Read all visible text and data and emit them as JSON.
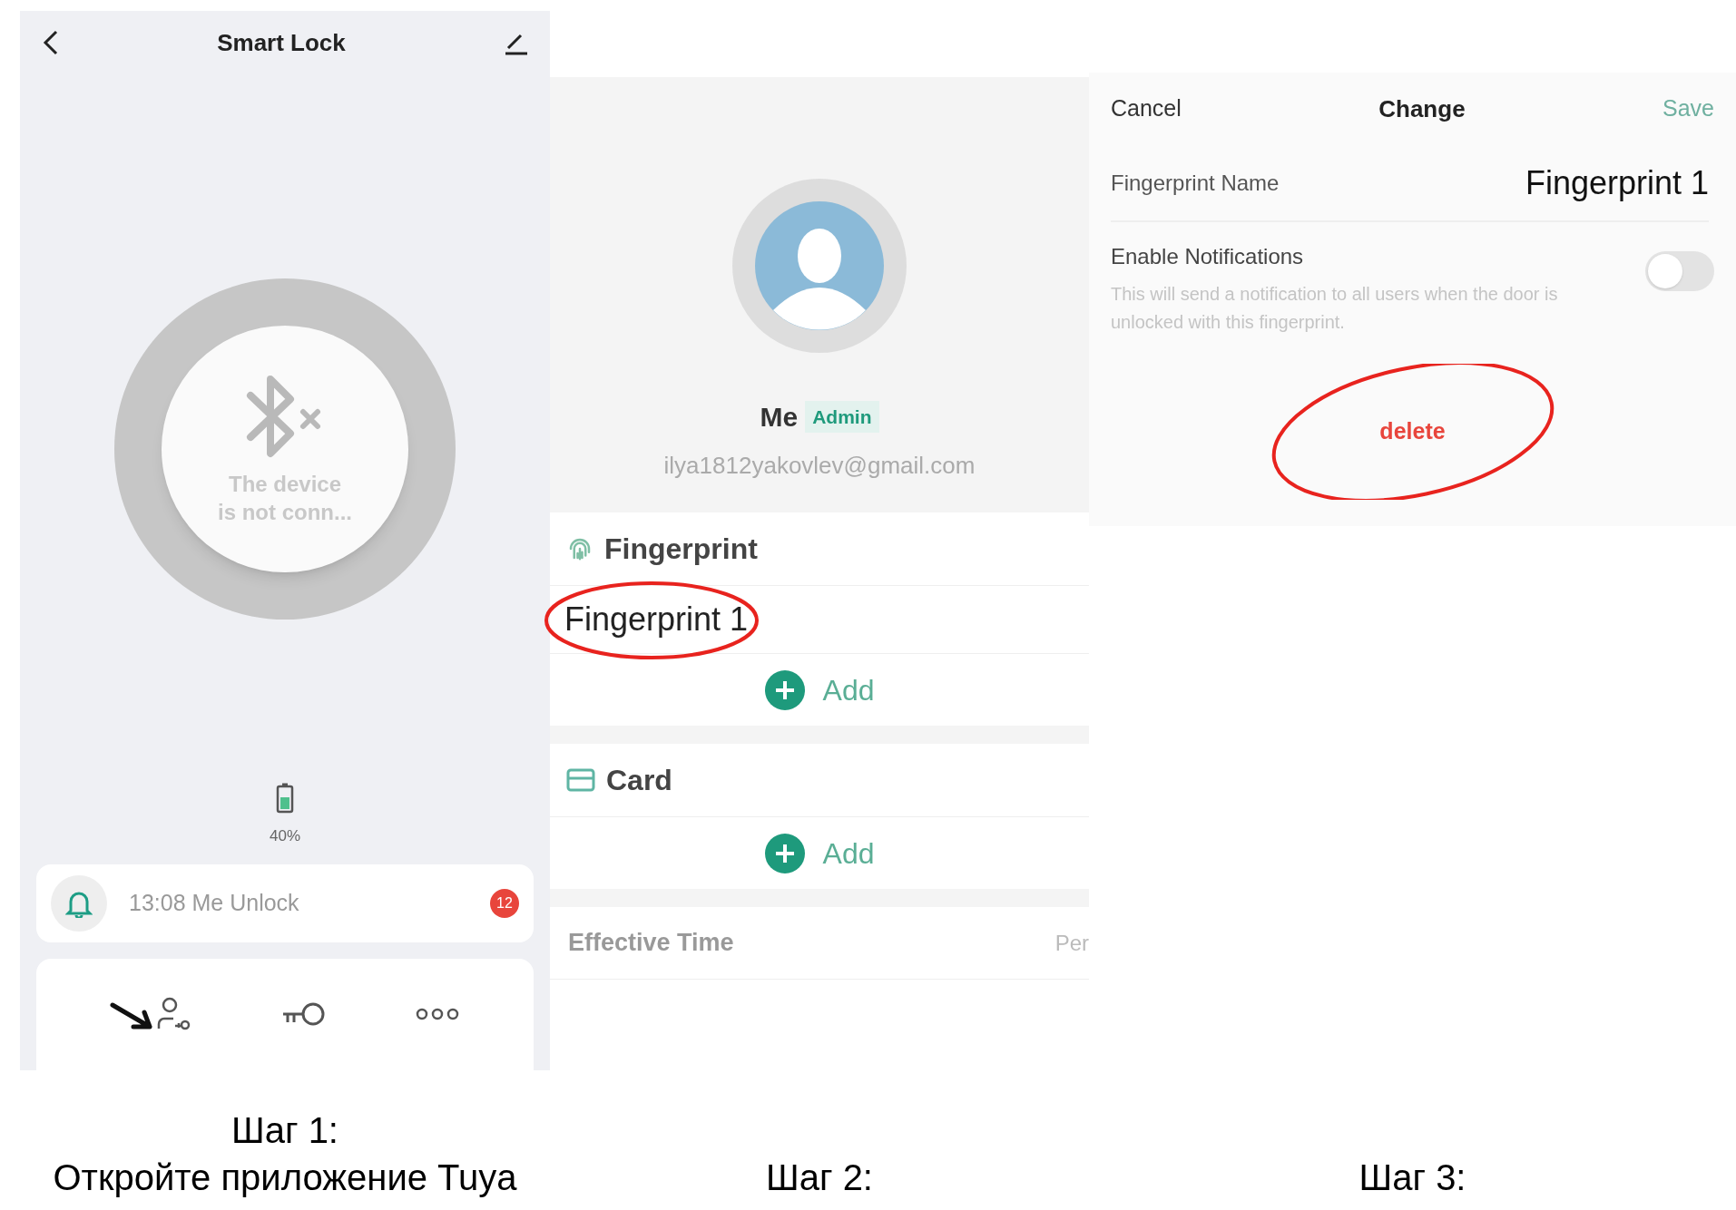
{
  "step1": {
    "title": "Smart Lock",
    "status": "The device\nis not conn...",
    "battery": "40%",
    "notification": {
      "text": "13:08 Me Unlock",
      "badge": "12"
    },
    "caption": [
      "Шаг 1:",
      "Откройте приложение Tuya"
    ]
  },
  "step2": {
    "name": "Me",
    "role": "Admin",
    "email": "ilya1812yakovlev@gmail.com",
    "sections": [
      {
        "kind": "fingerprint",
        "title": "Fingerprint",
        "items": [
          "Fingerprint 1"
        ],
        "add": "Add"
      },
      {
        "kind": "card",
        "title": "Card",
        "add": "Add"
      }
    ],
    "effective_time": {
      "label": "Effective Time",
      "value": "Per"
    },
    "caption": "Шаг 2:"
  },
  "step3": {
    "cancel": "Cancel",
    "title": "Change",
    "save": "Save",
    "name_label": "Fingerprint Name",
    "name_value": "Fingerprint 1",
    "notify_label": "Enable Notifications",
    "notify_desc": "This will send a notification to all users when the door is unlocked with this fingerprint.",
    "notify_on": false,
    "delete": "delete",
    "caption": "Шаг 3:"
  }
}
